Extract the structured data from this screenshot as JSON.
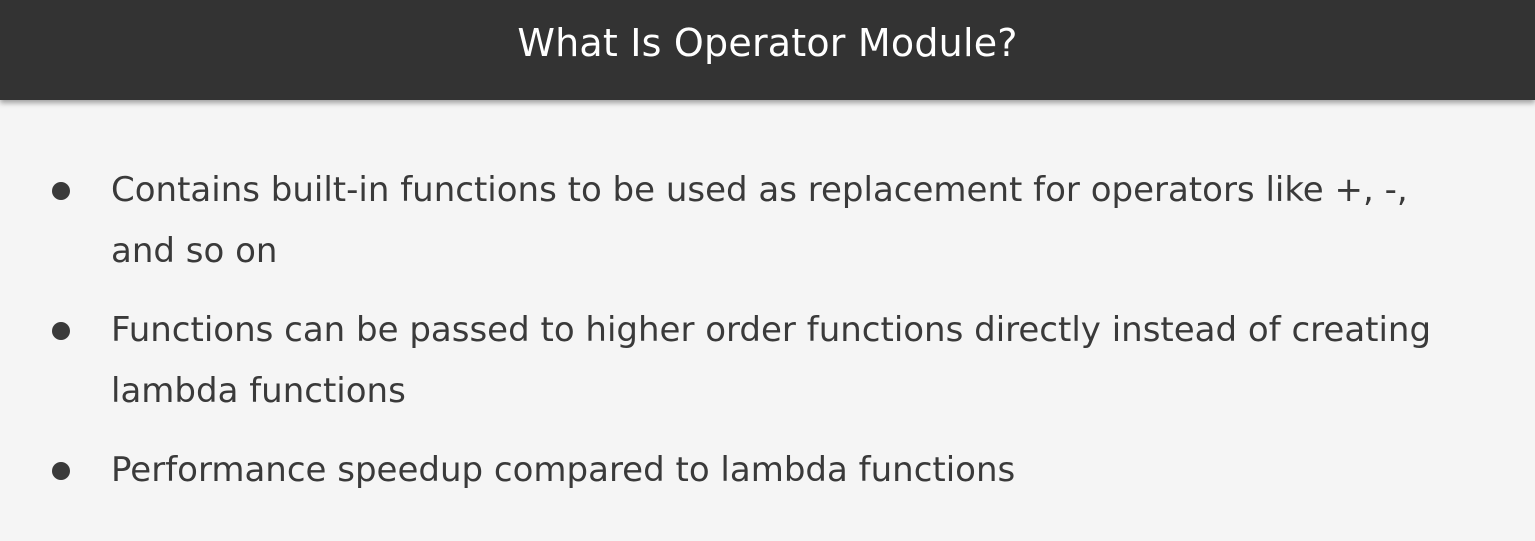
{
  "slide": {
    "title": "What Is Operator Module?",
    "bullets": [
      {
        "lines": [
          "Contains built-in functions to be used as replacement for operators like +, -,",
          "and so on"
        ]
      },
      {
        "lines": [
          "Functions can be passed to higher order functions directly instead of creating",
          "lambda functions"
        ]
      },
      {
        "lines": [
          "Performance speedup compared to lambda functions"
        ]
      }
    ]
  },
  "colors": {
    "title_bar": "#333333",
    "title_text": "#ffffff",
    "background": "#f5f5f5",
    "body_text": "#3a3a3a"
  }
}
